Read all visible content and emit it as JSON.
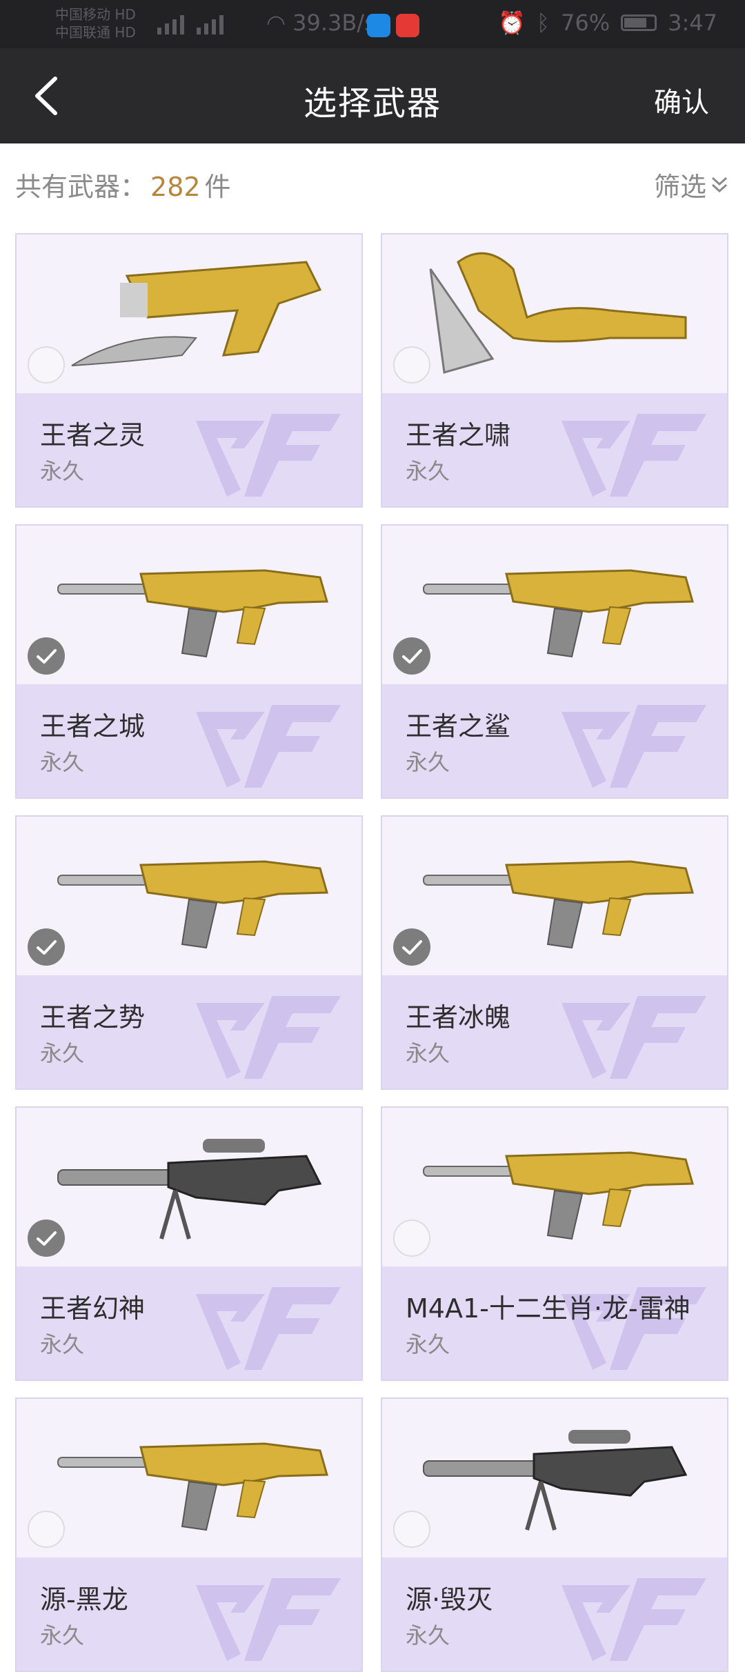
{
  "status_bar": {
    "carrier1": "中国移动",
    "carrier1_badge": "HD",
    "carrier2": "中国联通",
    "carrier2_badge": "HD",
    "network_speed": "39.3B/s",
    "battery_percent": "76%",
    "time": "3:47"
  },
  "header": {
    "title": "选择武器",
    "confirm_label": "确认"
  },
  "summary": {
    "prefix": "共有武器：",
    "count": "282",
    "unit": "件",
    "filter_label": "筛选"
  },
  "weapons": [
    {
      "name": "王者之灵",
      "duration": "永久",
      "selected": false,
      "icon": "pistol-blade-icon"
    },
    {
      "name": "王者之啸",
      "duration": "永久",
      "selected": false,
      "icon": "axe-icon"
    },
    {
      "name": "王者之城",
      "duration": "永久",
      "selected": true,
      "icon": "rifle-icon"
    },
    {
      "name": "王者之鲨",
      "duration": "永久",
      "selected": true,
      "icon": "rifle-icon"
    },
    {
      "name": "王者之势",
      "duration": "永久",
      "selected": true,
      "icon": "rifle-icon"
    },
    {
      "name": "王者冰魄",
      "duration": "永久",
      "selected": true,
      "icon": "rifle-icon"
    },
    {
      "name": "王者幻神",
      "duration": "永久",
      "selected": true,
      "icon": "sniper-icon"
    },
    {
      "name": "M4A1-十二生肖·龙-雷神",
      "duration": "永久",
      "selected": false,
      "icon": "rifle-icon"
    },
    {
      "name": "源-黑龙",
      "duration": "永久",
      "selected": false,
      "icon": "rifle-icon"
    },
    {
      "name": "源·毁灭",
      "duration": "永久",
      "selected": false,
      "icon": "sniper-icon"
    }
  ],
  "colors": {
    "header_bg": "#2a2a2c",
    "count_accent": "#b8863b",
    "card_bottom": "#e3daf5",
    "gold": "#d8b23a"
  }
}
